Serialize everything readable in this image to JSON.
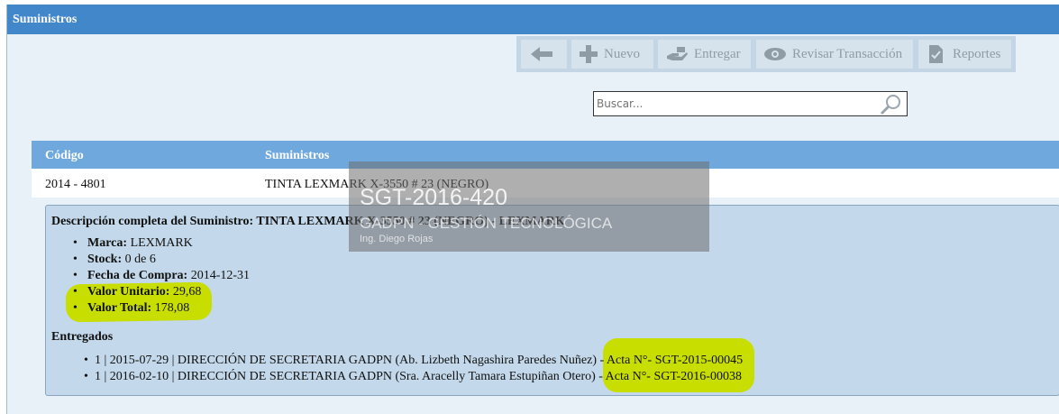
{
  "header": {
    "title": "Suministros"
  },
  "toolbar": {
    "new_label": "Nuevo",
    "deliver_label": "Entregar",
    "review_label": "Revisar Transacción",
    "reports_label": "Reportes"
  },
  "search": {
    "placeholder": "Buscar...",
    "value": ""
  },
  "table": {
    "columns": [
      "Código",
      "Suministros"
    ],
    "rows": [
      {
        "code": "2014 - 4801",
        "name": "TINTA LEXMARK X-3550 # 23 (NEGRO)"
      }
    ]
  },
  "detail": {
    "desc_label": "Descripción completa del Suministro:",
    "desc_value": "TINTA LEXMARK X-3550 # 23 (NEGRO) - LEXMARK",
    "props": [
      {
        "label": "Marca:",
        "value": "LEXMARK"
      },
      {
        "label": "Stock:",
        "value": "0 de 6"
      },
      {
        "label": "Fecha de Compra:",
        "value": "2014-12-31"
      },
      {
        "label": "Valor Unitario:",
        "value": "29,68"
      },
      {
        "label": "Valor Total:",
        "value": "178,08"
      }
    ],
    "deliveries_title": "Entregados",
    "deliveries": [
      "1 | 2015-07-29 | DIRECCIÓN DE SECRETARIA GADPN (Ab. Lizbeth Nagashira Paredes Nuñez) - Acta N°- SGT-2015-00045",
      "1 | 2016-02-10 | DIRECCIÓN DE SECRETARIA GADPN (Sra. Aracelly Tamara Estupiñan Otero) - Acta N°- SGT-2016-00038"
    ]
  },
  "watermark": {
    "code": "SGT-2016-420",
    "org": "GADPN - GESTIÓN TECNOLÓGICA",
    "person": "Ing. Diego Rojas"
  },
  "colors": {
    "header": "#4187c9",
    "table_header": "#6fa8dc",
    "detail_bg": "#c3d8ea",
    "highlight": "#c8de00"
  }
}
